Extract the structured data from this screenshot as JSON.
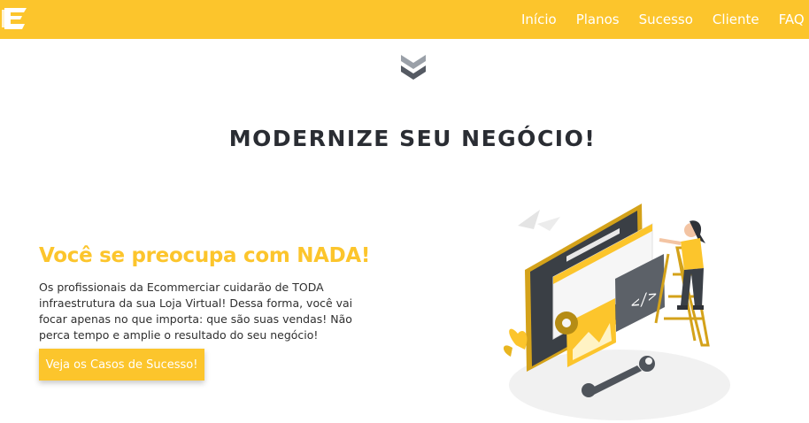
{
  "brand": {
    "logo_icon": "ecommerciar-logo-icon"
  },
  "nav": {
    "items": [
      {
        "label": "Início"
      },
      {
        "label": "Planos"
      },
      {
        "label": "Sucesso"
      },
      {
        "label": "Cliente"
      },
      {
        "label": "FAQ"
      }
    ]
  },
  "section": {
    "scroll_icon": "double-chevron-down-icon",
    "headline": "MODERNIZE SEU NEGÓCIO!"
  },
  "feature": {
    "title": "Você se preocupa com NADA!",
    "paragraph": "Os profissionais da Ecommerciar cuidarão de TODA infraestrutura da sua Loja Virtual! Dessa forma, você vai focar apenas no que importa: que são suas vendas! Não perca tempo e amplie o resultado do seu negócio!",
    "cta_label": "Veja os Casos de Sucesso!",
    "illustration": "web-development-illustration"
  },
  "colors": {
    "brand_yellow": "#fcc52c",
    "headline_text": "#2a2d33",
    "chevron_gray": "#666b73"
  }
}
